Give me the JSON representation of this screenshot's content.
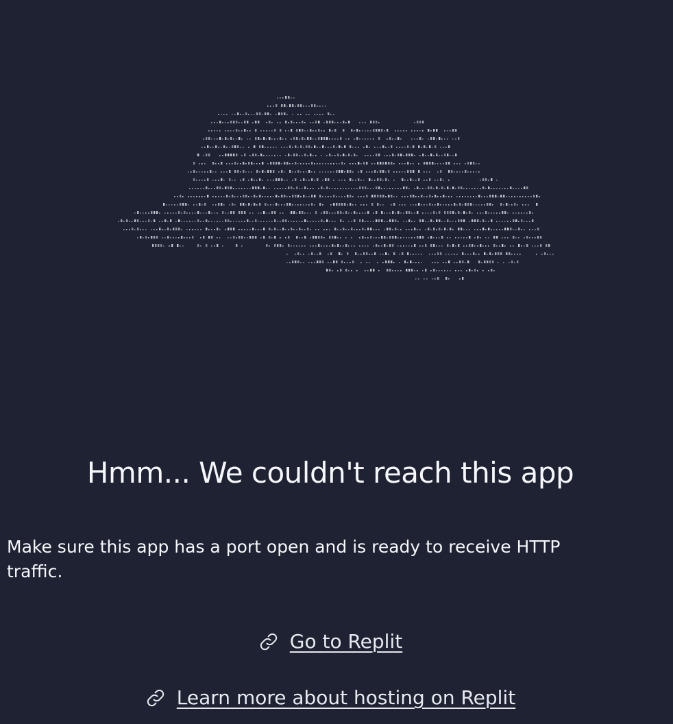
{
  "heading": "Hmm... We couldn't reach this app",
  "message": "Make sure this app has a port open and is ready to receive HTTP traffic.",
  "links": [
    {
      "label": "Go to Replit",
      "icon": "link-icon"
    },
    {
      "label": "Learn more about hosting on Replit",
      "icon": "link-icon"
    }
  ],
  "colors": {
    "background": "#1f2232",
    "text": "#f5f7fa",
    "art": "#c8ccd6"
  },
  "illustration": "ascii-art-cloud"
}
